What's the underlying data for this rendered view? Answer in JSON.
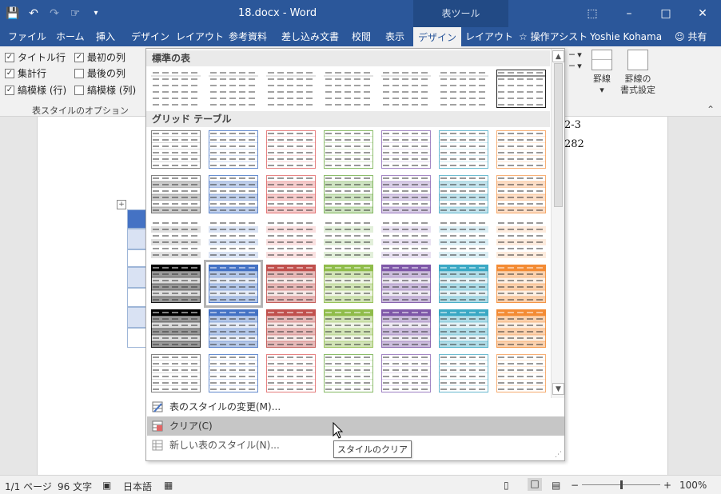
{
  "titlebar": {
    "title": "18.docx - Word",
    "context_tools": "表ツール",
    "qat": {
      "save_icon": "save-icon",
      "undo_icon": "undo-icon",
      "redo_icon": "redo-icon",
      "touch_icon": "touch-mode-icon",
      "customize_icon": "customize-qat-icon"
    }
  },
  "tabs": [
    "ファイル",
    "ホーム",
    "挿入",
    "デザイン",
    "レイアウト",
    "参考資料",
    "差し込み文書",
    "校閲",
    "表示",
    "デザイン",
    "レイアウト"
  ],
  "tell_me": "操作アシスト",
  "user": "Yoshie Kohama",
  "share": "共有",
  "ribbon": {
    "options": [
      {
        "label": "タイトル行",
        "checked": true
      },
      {
        "label": "最初の列",
        "checked": true
      },
      {
        "label": "集計行",
        "checked": true
      },
      {
        "label": "最後の列",
        "checked": false
      },
      {
        "label": "縞模様 (行)",
        "checked": true
      },
      {
        "label": "縞模様 (列)",
        "checked": false
      }
    ],
    "options_group": "表スタイルのオプション",
    "borders_label": "罫線",
    "border_painter_label_1": "罫線の",
    "border_painter_label_2": "書式設定"
  },
  "document": {
    "text_1": "2-3",
    "text_2": "282"
  },
  "gallery": {
    "section_plain": "標準の表",
    "section_grid": "グリッド テーブル",
    "plain_colors": [
      "#888888",
      "#888888",
      "#888888",
      "#888888",
      "#888888",
      "#888888",
      "#222222"
    ],
    "grid_colors": [
      "#666666",
      "#4472c4",
      "#e06666",
      "#70ad47",
      "#8e6bb7",
      "#4bacc6",
      "#f59d56"
    ],
    "dark_colors": [
      "#000000",
      "#4472c4",
      "#c0504d",
      "#8fbc4a",
      "#7e57a8",
      "#3aa8c4",
      "#f38b34"
    ],
    "menu": [
      {
        "label": "表のスタイルの変更(M)...",
        "icon": "modify-style-icon"
      },
      {
        "label": "クリア(C)",
        "icon": "clear-style-icon"
      },
      {
        "label": "新しい表のスタイル(N)...",
        "icon": "new-style-icon"
      }
    ],
    "tooltip": "スタイルのクリア"
  },
  "status": {
    "page": "1/1 ページ",
    "words": "96 文字",
    "language": "日本語",
    "zoom": "100%",
    "zoom_level": 1.0
  }
}
